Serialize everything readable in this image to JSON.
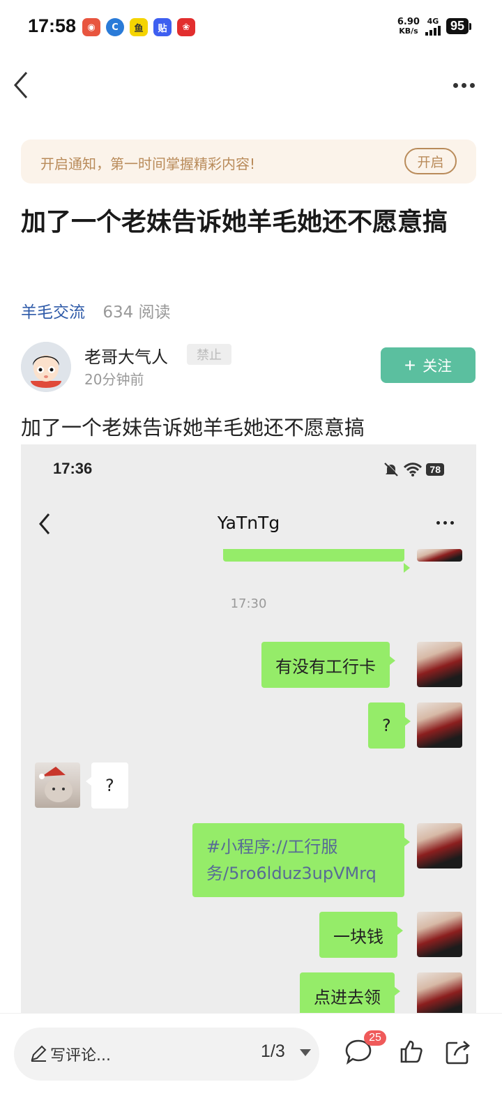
{
  "status_bar": {
    "time": "17:58",
    "app_icons": [
      "weibo-icon",
      "hd-icon",
      "xianyu-icon",
      "tieba-icon",
      "pinduoduo-icon"
    ],
    "net_speed_value": "6.90",
    "net_speed_unit": "KB/s",
    "network": "4G",
    "battery": "95"
  },
  "notify": {
    "text": "开启通知，第一时间掌握精彩内容!",
    "button": "开启"
  },
  "post": {
    "title": "加了一个老妹告诉她羊毛她还不愿意搞",
    "category": "羊毛交流",
    "reads": "634 阅读",
    "author": "老哥大气人",
    "author_badge": "禁止",
    "time_ago": "20分钟前",
    "follow_label": "关注",
    "body": "加了一个老妹告诉她羊毛她还不愿意搞"
  },
  "screenshot": {
    "time": "17:36",
    "battery": "78",
    "chat_title": "YaTnTg",
    "timestamp": "17:30",
    "messages": [
      {
        "side": "out",
        "text": "有没有工行卡"
      },
      {
        "side": "out",
        "text": "?"
      },
      {
        "side": "in",
        "text": "?"
      },
      {
        "side": "out",
        "line1": "#小程序://工行服",
        "line2": "务/5ro6lduz3upVMrq"
      },
      {
        "side": "out",
        "text": "一块钱"
      },
      {
        "side": "out",
        "text": "点进去领"
      }
    ]
  },
  "bottom": {
    "comment_placeholder": "写评论...",
    "page": "1/3",
    "comment_count": "25"
  },
  "colors": {
    "follow": "#5bbf9f",
    "category": "#2e5aa8",
    "notify_text": "#b98b5a",
    "wechat_green": "#95ec69",
    "badge_red": "#ef5a5a"
  }
}
